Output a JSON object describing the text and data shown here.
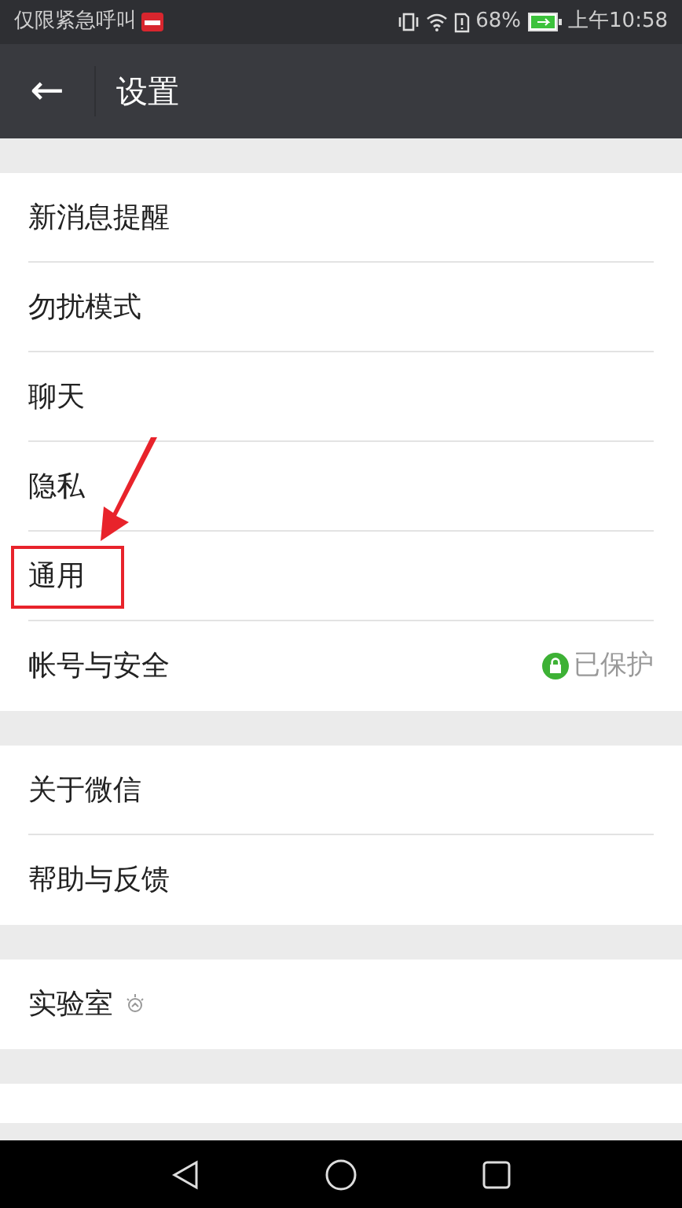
{
  "status_bar": {
    "carrier": "仅限紧急呼叫",
    "battery": "68%",
    "time": "上午10:58"
  },
  "header": {
    "back": "←",
    "title": "设置"
  },
  "groups": [
    {
      "items": [
        {
          "label": "新消息提醒"
        },
        {
          "label": "勿扰模式"
        },
        {
          "label": "聊天"
        },
        {
          "label": "隐私"
        },
        {
          "label": "通用",
          "highlighted": true
        },
        {
          "label": "帐号与安全",
          "status": "已保护"
        }
      ]
    },
    {
      "items": [
        {
          "label": "关于微信"
        },
        {
          "label": "帮助与反馈"
        }
      ]
    },
    {
      "items": [
        {
          "label": "实验室",
          "bulb": true
        }
      ]
    }
  ]
}
